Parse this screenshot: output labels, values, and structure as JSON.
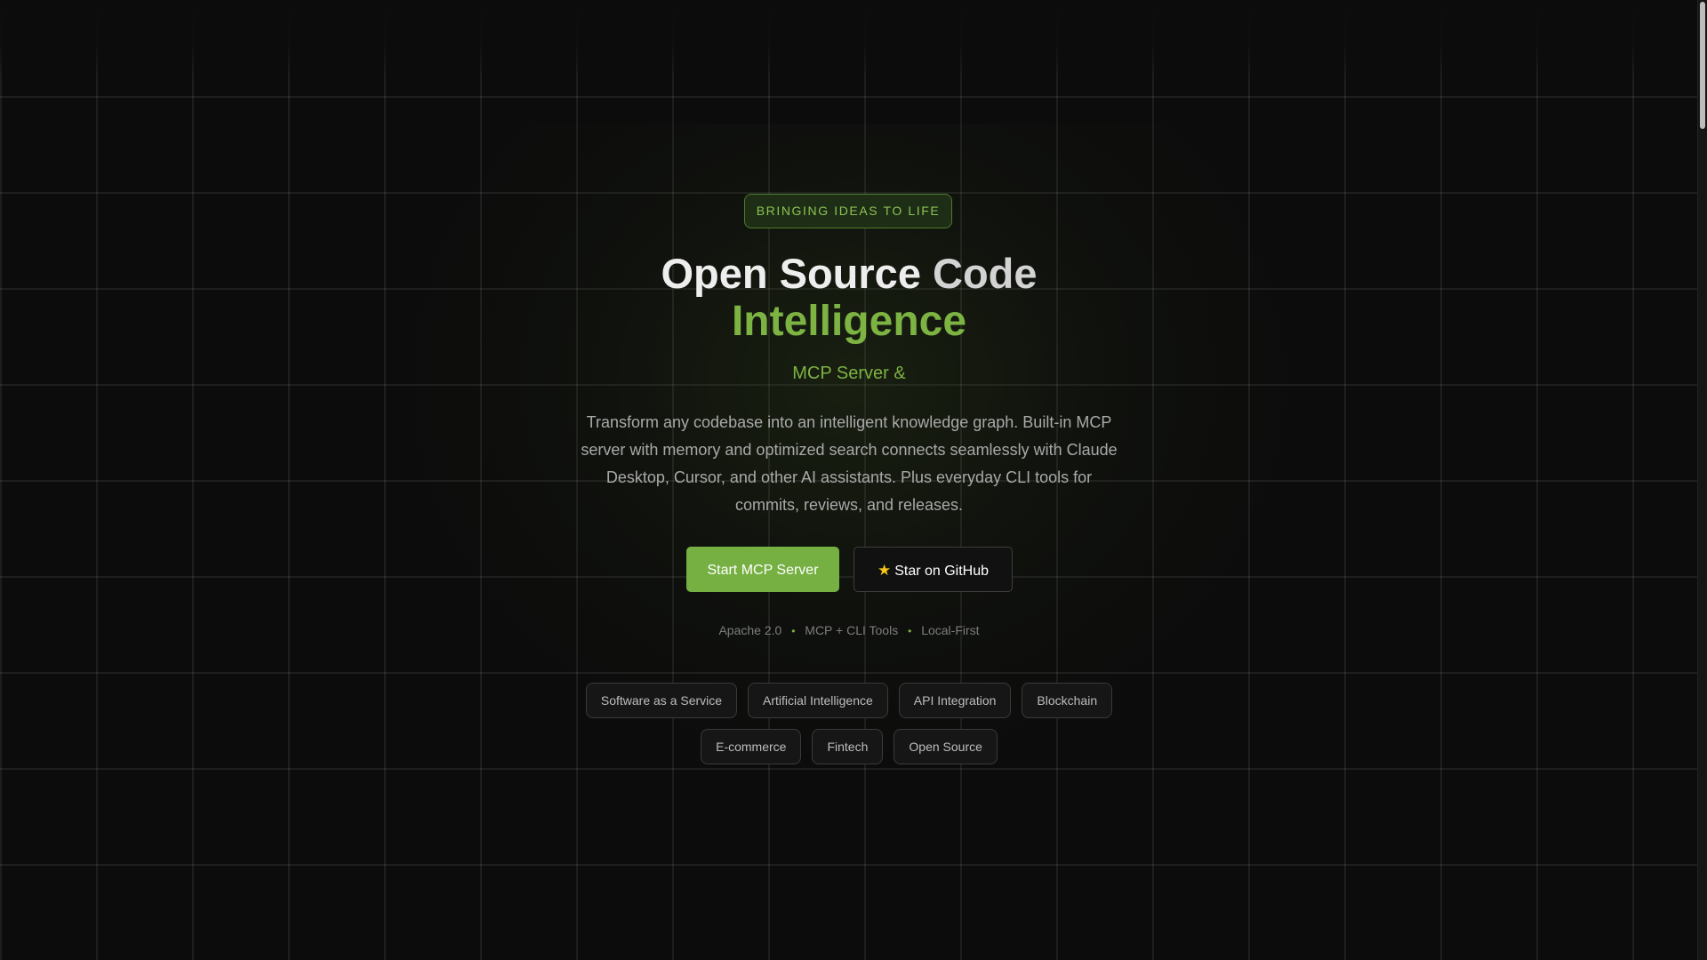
{
  "hero": {
    "badge": "BRINGING IDEAS TO LIFE",
    "title_part1": "Open Source ",
    "title_part2": "Code",
    "title_highlight": "Intelligence",
    "subtitle": "MCP Server &",
    "description": "Transform any codebase into an intelligent knowledge graph. Built-in MCP server with memory and optimized search connects seamlessly with Claude Desktop, Cursor, and other AI assistants. Plus everyday CLI tools for commits, reviews, and releases.",
    "primary_button": "Start MCP Server",
    "secondary_button": "Star on GitHub",
    "secondary_button_icon": "star-icon"
  },
  "meta": {
    "items": [
      "Apache 2.0",
      "MCP + CLI Tools",
      "Local-First"
    ]
  },
  "tags": {
    "items": [
      "Software as a Service",
      "Artificial Intelligence",
      "API Integration",
      "Blockchain",
      "E-commerce",
      "Fintech",
      "Open Source"
    ]
  },
  "colors": {
    "accent": "#7cb342",
    "button": "#76b043",
    "background": "#0c0c0c",
    "star": "#f5c518"
  }
}
